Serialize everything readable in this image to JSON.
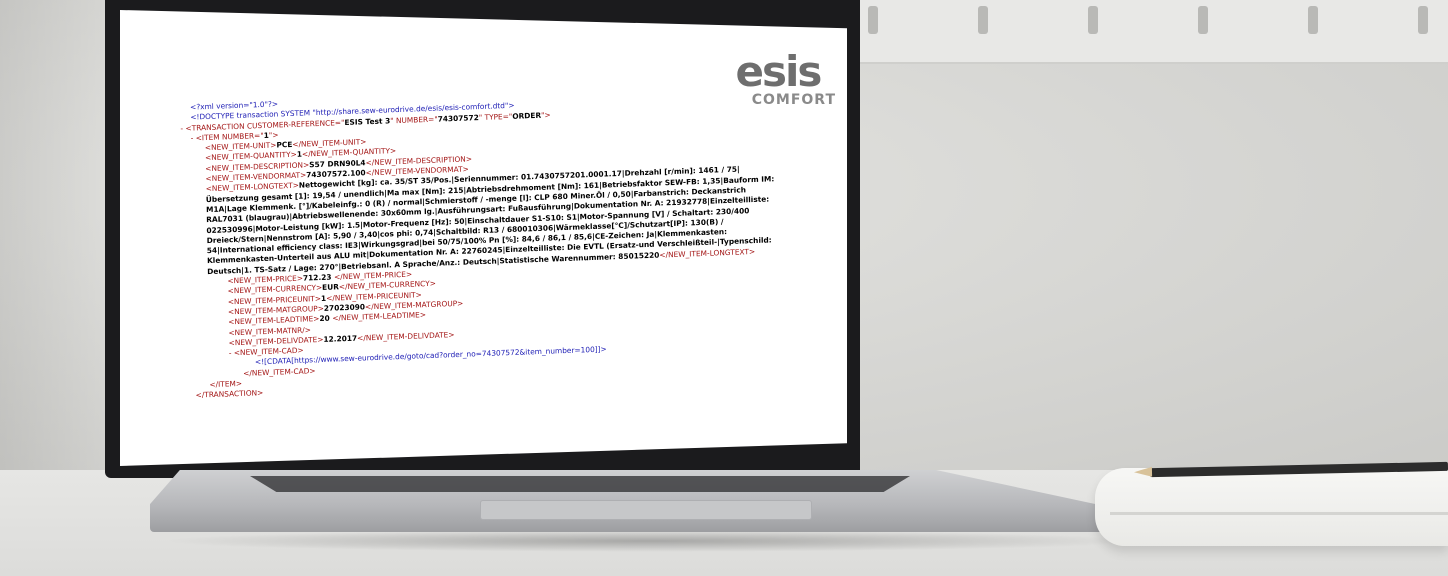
{
  "logo": {
    "main": "esis",
    "sub": "COMFORT"
  },
  "xml": {
    "decl": "<?xml version=\"1.0\"?>",
    "doctype": "<!DOCTYPE transaction SYSTEM \"http://share.sew-eurodrive.de/esis/esis-comfort.dtd\">",
    "transaction_open": {
      "prefix": "- <TRANSACTION CUSTOMER-REFERENCE=\"",
      "customer_ref": "ESIS Test 3",
      "mid1": "\" NUMBER=\"",
      "number": "74307572",
      "mid2": "\" TYPE=\"",
      "type": "ORDER",
      "end": "\">"
    },
    "item_open": {
      "prefix": "- <ITEM NUMBER=\"",
      "number": "1",
      "end": "\">"
    },
    "fields": {
      "unit": {
        "open": "<NEW_ITEM-UNIT>",
        "value": "PCE",
        "close": "</NEW_ITEM-UNIT>"
      },
      "quantity": {
        "open": "<NEW_ITEM-QUANTITY>",
        "value": "1",
        "close": "</NEW_ITEM-QUANTITY>"
      },
      "description": {
        "open": "<NEW_ITEM-DESCRIPTION>",
        "value": "S57 DRN90L4",
        "close": "</NEW_ITEM-DESCRIPTION>"
      },
      "vendormat": {
        "open": "<NEW_ITEM-VENDORMAT>",
        "value": "74307572.100",
        "close": "</NEW_ITEM-VENDORMAT>"
      },
      "longtext": {
        "open": "<NEW_ITEM-LONGTEXT>",
        "value": "Nettogewicht [kg]: ca. 35/ST 35/Pos.|Seriennummer: 01.7430757201.0001.17|Drehzahl [r/min]: 1461 / 75|Übersetzung gesamt [1]: 19,54 / unendlich|Ma max [Nm]: 215|Abtriebsdrehmoment [Nm]: 161|Betriebsfaktor SEW-FB: 1,35|Bauform IM: M1A|Lage Klemmenk. [°]/Kabeleinfg.: 0 (R) / normal|Schmierstoff / -menge [l]: CLP 680 Miner.Öl / 0,50|Farbanstrich: Deckanstrich RAL7031 (blaugrau)|Abtriebswellenende: 30x60mm lg.|Ausführungsart: Fußausführung|Dokumentation Nr. A: 21932778|Einzelteilliste: 022530996|Motor-Leistung [kW]: 1.5|Motor-Frequenz [Hz]: 50|Einschaltdauer S1-S10: S1|Motor-Spannung [V] / Schaltart: 230/400 Dreieck/Stern|Nennstrom [A]: 5,90 / 3,40|cos phi: 0,74|Schaltbild: R13 / 680010306|Wärmeklasse[°C]/Schutzart[IP]: 130(B) / 54|International efficiency class: IE3|Wirkungsgrad|bei 50/75/100% Pn [%]: 84,6 / 86,1 / 85,6|CE-Zeichen: Ja|Klemmenkasten: Klemmenkasten-Unterteil aus ALU mit|Dokumentation Nr. A: 22760245|Einzelteilliste: Die EVTL (Ersatz-und Verschleißteil-|Typenschild: Deutsch|1. TS-Satz / Lage: 270°|Betriebsanl. A Sprache/Anz.: Deutsch|Statistische Warennummer: 85015220",
        "close": "</NEW_ITEM-LONGTEXT>"
      },
      "price": {
        "open": "<NEW_ITEM-PRICE>",
        "value": "712.23 ",
        "close": "</NEW_ITEM-PRICE>"
      },
      "currency": {
        "open": "<NEW_ITEM-CURRENCY>",
        "value": "EUR",
        "close": "</NEW_ITEM-CURRENCY>"
      },
      "priceunit": {
        "open": "<NEW_ITEM-PRICEUNIT>",
        "value": "1",
        "close": "</NEW_ITEM-PRICEUNIT>"
      },
      "matgroup": {
        "open": "<NEW_ITEM-MATGROUP>",
        "value": "27023090",
        "close": "</NEW_ITEM-MATGROUP>"
      },
      "leadtime": {
        "open": "<NEW_ITEM-LEADTIME>",
        "value": "20 ",
        "close": "</NEW_ITEM-LEADTIME>"
      },
      "matnr": "<NEW_ITEM-MATNR/>",
      "delivdate": {
        "open": "<NEW_ITEM-DELIVDATE>",
        "value": "12.2017",
        "close": "</NEW_ITEM-DELIVDATE>"
      }
    },
    "cad_open": "- <NEW_ITEM-CAD>",
    "cdata": "<![CDATA[https://www.sew-eurodrive.de/goto/cad?order_no=74307572&item_number=100]]>",
    "cad_close": "</NEW_ITEM-CAD>",
    "item_close": "</ITEM>",
    "transaction_close": "</TRANSACTION>"
  }
}
